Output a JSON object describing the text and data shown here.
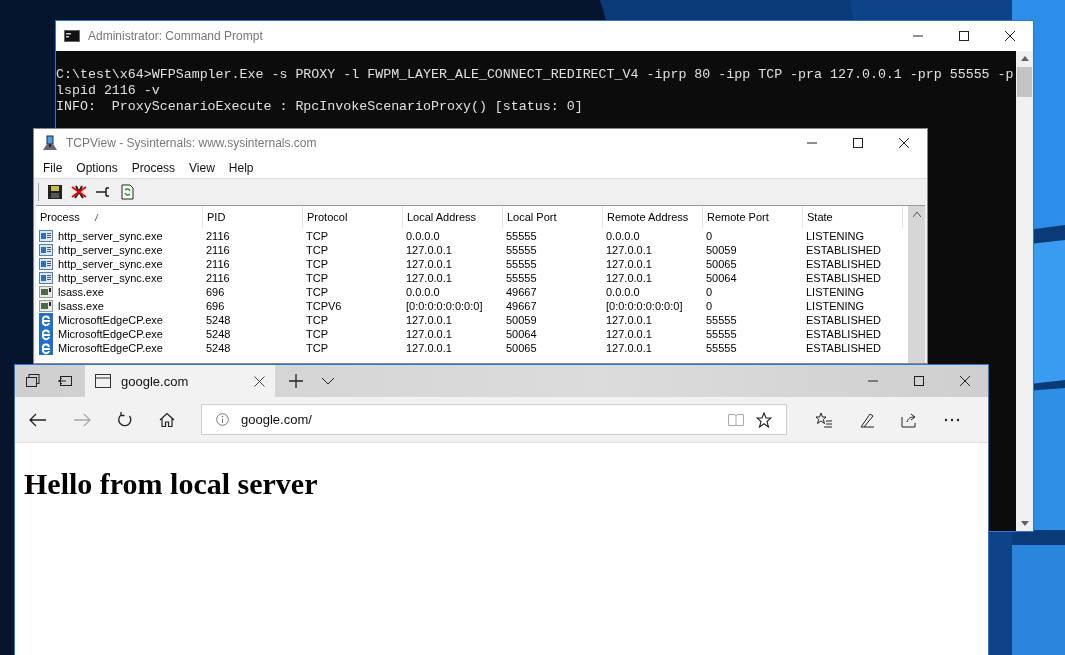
{
  "command_prompt": {
    "title": "Administrator: Command Prompt",
    "lines": [
      "C:\\test\\x64>WFPSampler.Exe -s PROXY -l FWPM_LAYER_ALE_CONNECT_REDIRECT_V4 -iprp 80 -ipp TCP -pra 127.0.0.1 -prp 55555 -p",
      "lspid 2116 -v",
      "INFO:  ProxyScenarioExecute : RpcInvokeScenarioProxy() [status: 0]"
    ]
  },
  "tcpview": {
    "title": "TCPView - Sysinternals: www.sysinternals.com",
    "menu": [
      "File",
      "Options",
      "Process",
      "View",
      "Help"
    ],
    "columns": [
      {
        "label": "Process",
        "sorted": true
      },
      {
        "label": "PID",
        "sorted": false
      },
      {
        "label": "Protocol",
        "sorted": false
      },
      {
        "label": "Local Address",
        "sorted": false
      },
      {
        "label": "Local Port",
        "sorted": false
      },
      {
        "label": "Remote Address",
        "sorted": false
      },
      {
        "label": "Remote Port",
        "sorted": false
      },
      {
        "label": "State",
        "sorted": false
      }
    ],
    "rows": [
      {
        "kind": "app",
        "cells": [
          "http_server_sync.exe",
          "2116",
          "TCP",
          "0.0.0.0",
          "55555",
          "0.0.0.0",
          "0",
          "LISTENING"
        ]
      },
      {
        "kind": "app",
        "cells": [
          "http_server_sync.exe",
          "2116",
          "TCP",
          "127.0.0.1",
          "55555",
          "127.0.0.1",
          "50059",
          "ESTABLISHED"
        ]
      },
      {
        "kind": "app",
        "cells": [
          "http_server_sync.exe",
          "2116",
          "TCP",
          "127.0.0.1",
          "55555",
          "127.0.0.1",
          "50065",
          "ESTABLISHED"
        ]
      },
      {
        "kind": "app",
        "cells": [
          "http_server_sync.exe",
          "2116",
          "TCP",
          "127.0.0.1",
          "55555",
          "127.0.0.1",
          "50064",
          "ESTABLISHED"
        ]
      },
      {
        "kind": "service",
        "cells": [
          "lsass.exe",
          "696",
          "TCP",
          "0.0.0.0",
          "49667",
          "0.0.0.0",
          "0",
          "LISTENING"
        ]
      },
      {
        "kind": "service",
        "cells": [
          "lsass.exe",
          "696",
          "TCPV6",
          "[0:0:0:0:0:0:0:0]",
          "49667",
          "[0:0:0:0:0:0:0:0]",
          "0",
          "LISTENING"
        ]
      },
      {
        "kind": "edge",
        "cells": [
          "MicrosoftEdgeCP.exe",
          "5248",
          "TCP",
          "127.0.0.1",
          "50059",
          "127.0.0.1",
          "55555",
          "ESTABLISHED"
        ]
      },
      {
        "kind": "edge",
        "cells": [
          "MicrosoftEdgeCP.exe",
          "5248",
          "TCP",
          "127.0.0.1",
          "50064",
          "127.0.0.1",
          "55555",
          "ESTABLISHED"
        ]
      },
      {
        "kind": "edge",
        "cells": [
          "MicrosoftEdgeCP.exe",
          "5248",
          "TCP",
          "127.0.0.1",
          "50065",
          "127.0.0.1",
          "55555",
          "ESTABLISHED"
        ]
      }
    ]
  },
  "browser": {
    "tabs": [
      {
        "title": "google.com",
        "selected": true
      }
    ],
    "address": "google.com/",
    "heading": "Hello from local server"
  }
}
